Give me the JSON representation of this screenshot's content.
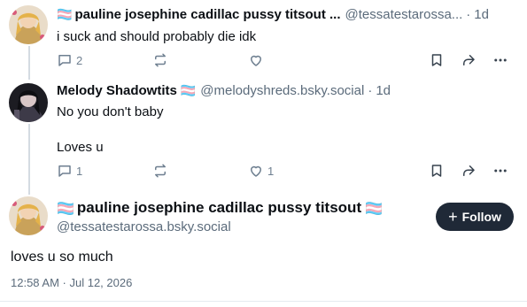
{
  "posts": [
    {
      "display_name": "pauline josephine cadillac pussy titsout ...",
      "flag_prefix": "🏳️‍⚧️",
      "handle": "@tessatestarossa...",
      "time": "1d",
      "text": "i suck and should probably die idk",
      "replies": "2",
      "likes": ""
    },
    {
      "display_name": "Melody Shadowtits",
      "flag_suffix": "🏳️‍⚧️",
      "handle": "@melodyshreds.bsky.social",
      "time": "1d",
      "text": "No you don't baby\n\nLoves u",
      "replies": "1",
      "likes": "1"
    }
  ],
  "focused": {
    "display_name": "pauline josephine cadillac pussy titsout",
    "flag_prefix": "🏳️‍⚧️",
    "flag_suffix": "🏳️‍⚧️",
    "handle": "@tessatestarossa.bsky.social",
    "follow_label": "Follow",
    "text": "loves u so much",
    "timestamp": "12:58 AM · Jul 12, 2026"
  },
  "colors": {
    "accent": "#1f2937",
    "muted": "#6e7f90",
    "thread_line": "#d4dbe2"
  },
  "icons": [
    "reply-icon",
    "repost-icon",
    "like-icon",
    "bookmark-icon",
    "share-icon",
    "more-icon",
    "plus-icon"
  ]
}
